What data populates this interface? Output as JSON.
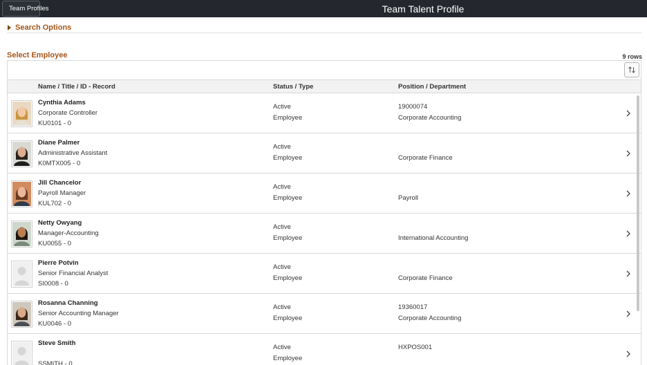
{
  "header": {
    "back_label": "Team Profiles",
    "title": "Team Talent Profile"
  },
  "search_options": {
    "label": "Search Options"
  },
  "section": {
    "title": "Select Employee",
    "rows_count": "9 rows"
  },
  "grid": {
    "columns": [
      "Name / Title / ID - Record",
      "Status / Type",
      "Position / Department"
    ],
    "rows": [
      {
        "name": "Cynthia Adams",
        "title": "Corporate Controller",
        "id": "KU0101 - 0",
        "status": "Active",
        "type": "Employee",
        "position": "19000074",
        "department": "Corporate Accounting",
        "photo": "photo-cynthia"
      },
      {
        "name": "Diane Palmer",
        "title": "Administrative Assistant",
        "id": "K0MTX005 - 0",
        "status": "Active",
        "type": "Employee",
        "position": "",
        "department": "Corporate Finance",
        "photo": "photo-diane"
      },
      {
        "name": "Jill Chancelor",
        "title": "Payroll Manager",
        "id": "KUL702 - 0",
        "status": "Active",
        "type": "Employee",
        "position": "",
        "department": "Payroll",
        "photo": "photo-jill"
      },
      {
        "name": "Netty Owyang",
        "title": "Manager-Accounting",
        "id": "KU0055 - 0",
        "status": "Active",
        "type": "Employee",
        "position": "",
        "department": "International Accounting",
        "photo": "photo-netty"
      },
      {
        "name": "Pierre Potvin",
        "title": "Senior Financial Analyst",
        "id": "SI0008 - 0",
        "status": "Active",
        "type": "Employee",
        "position": "",
        "department": "Corporate Finance",
        "photo": "placeholder"
      },
      {
        "name": "Rosanna Channing",
        "title": "Senior Accounting Manager",
        "id": "KU0046 - 0",
        "status": "Active",
        "type": "Employee",
        "position": "19360017",
        "department": "Corporate Accounting",
        "photo": "photo-rosanna"
      },
      {
        "name": "Steve Smith",
        "title": "",
        "id": "SSMITH - 0",
        "status": "Active",
        "type": "Employee",
        "position": "HXPOS001",
        "department": "",
        "photo": "placeholder"
      }
    ]
  },
  "icons": {
    "back": "chevron-left-icon",
    "expand": "triangle-right-icon",
    "sort": "sort-icon",
    "row_nav": "chevron-right-icon"
  },
  "colors": {
    "header_bg": "#24282e",
    "accent": "#a4561a"
  }
}
